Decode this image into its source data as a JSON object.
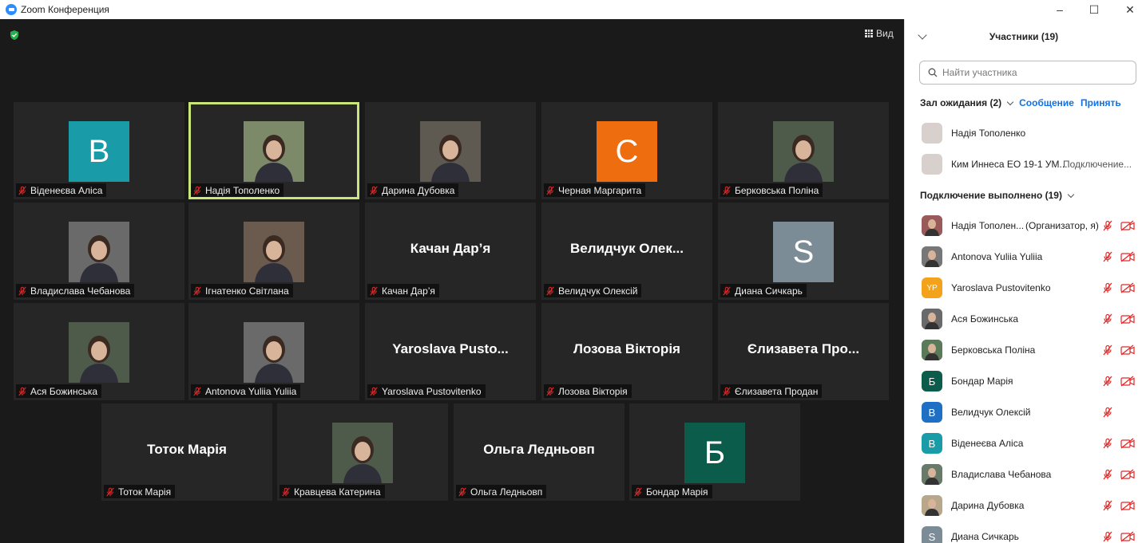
{
  "window": {
    "title": "Zoom Конференция",
    "minimize": "–",
    "maximize": "☐",
    "close": "✕"
  },
  "toolbar": {
    "view_label": "Вид"
  },
  "tiles": [
    {
      "name": "Віденеєва Аліса",
      "kind": "avatar",
      "letter": "B",
      "color": "#1a9ba8"
    },
    {
      "name": "Надія Тополенко",
      "kind": "photo",
      "active": true
    },
    {
      "name": "Дарина Дубовка",
      "kind": "photo"
    },
    {
      "name": "Черная Маргарита",
      "kind": "avatar",
      "letter": "C",
      "color": "#ee6d0e"
    },
    {
      "name": "Берковська Поліна",
      "kind": "photo"
    },
    {
      "name": "Владислава Чебанова",
      "kind": "photo"
    },
    {
      "name": "Ігнатенко Світлана",
      "kind": "photo"
    },
    {
      "name": "Качан Дар’я",
      "kind": "text",
      "display": "Качан Дар’я"
    },
    {
      "name": "Велидчук Олексій",
      "kind": "text",
      "display": "Велидчук Олек..."
    },
    {
      "name": "Диана Сичкарь",
      "kind": "avatar",
      "letter": "S",
      "color": "#7c8c97"
    },
    {
      "name": "Ася Божинська",
      "kind": "photo"
    },
    {
      "name": "Antonova Yuliia Yuliia",
      "kind": "photo"
    },
    {
      "name": "Yaroslava Pustovitenko",
      "kind": "text",
      "display": "Yaroslava Pusto..."
    },
    {
      "name": "Лозова Вікторія",
      "kind": "text",
      "display": "Лозова Вікторія"
    },
    {
      "name": "Єлизавета Продан",
      "kind": "text",
      "display": "Єлизавета Про..."
    },
    {
      "name": "Тоток Марія",
      "kind": "text",
      "display": "Тоток Марія"
    },
    {
      "name": "Кравцева Катерина",
      "kind": "photo"
    },
    {
      "name": "Ольга Ледньовп",
      "kind": "text",
      "display": "Ольга Ледньовп"
    },
    {
      "name": "Бондар Марія",
      "kind": "avatar",
      "letter": "Б",
      "color": "#0c5c4c"
    }
  ],
  "panel": {
    "title": "Участники (19)",
    "search_placeholder": "Найти участника",
    "waiting": {
      "label": "Зал ожидания (2)",
      "message_action": "Сообщение",
      "admit_action": "Принять",
      "people": [
        {
          "name": "Надія Тополенко",
          "status": ""
        },
        {
          "name": "Ким Иннеса ЕО 19-1 УМ...",
          "status": "Подключение..."
        }
      ]
    },
    "joined": {
      "label": "Подключение выполнено (19)",
      "people": [
        {
          "name": "Надія Тополен...",
          "role": "(Организатор, я)",
          "kind": "photo",
          "color": "#9a5a5a"
        },
        {
          "name": "Antonova Yuliia Yuliia",
          "kind": "photo",
          "color": "#777777"
        },
        {
          "name": "Yaroslava Pustovitenko",
          "kind": "initials",
          "initials": "YP",
          "color": "#f2a21b"
        },
        {
          "name": "Ася Божинська",
          "kind": "photo",
          "color": "#6a6a6a"
        },
        {
          "name": "Берковська Поліна",
          "kind": "photo",
          "color": "#5a7a5a"
        },
        {
          "name": "Бондар Марія",
          "kind": "initials",
          "initials": "Б",
          "color": "#0c5c4c"
        },
        {
          "name": "Велидчук Олексій",
          "kind": "initials",
          "initials": "B",
          "color": "#1f6fc4",
          "no_cam": true
        },
        {
          "name": "Віденеєва Аліса",
          "kind": "initials",
          "initials": "B",
          "color": "#1a9ba8"
        },
        {
          "name": "Владислава Чебанова",
          "kind": "photo",
          "color": "#6a7a6a"
        },
        {
          "name": "Дарина Дубовка",
          "kind": "photo",
          "color": "#b8a78a"
        },
        {
          "name": "Диана Сичкарь",
          "kind": "initials",
          "initials": "S",
          "color": "#7c8c97"
        }
      ]
    }
  }
}
